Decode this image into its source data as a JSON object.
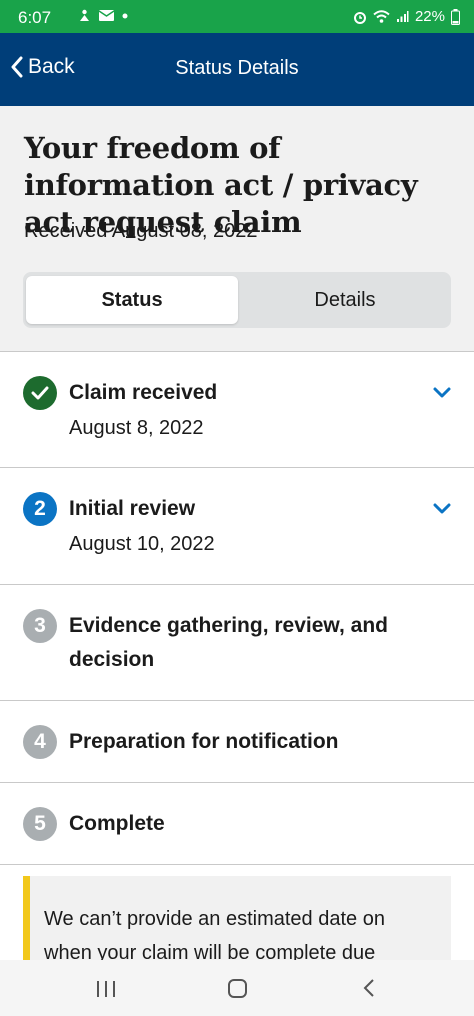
{
  "status_bar": {
    "time": "6:07",
    "battery": "22%",
    "icons_left": [
      "bluetooth-person-icon",
      "mail-icon",
      "dot-icon"
    ],
    "icons_right": [
      "alarm-icon",
      "wifi-icon",
      "signal-icon"
    ]
  },
  "nav": {
    "back_label": "Back",
    "title": "Status Details"
  },
  "header": {
    "title": "Your freedom of information act / privacy act request claim",
    "received": "Received August 08, 2022"
  },
  "tabs": [
    {
      "label": "Status",
      "selected": true
    },
    {
      "label": "Details",
      "selected": false
    }
  ],
  "steps": [
    {
      "number": "1",
      "state": "complete",
      "title": "Claim received",
      "date": "August 8, 2022",
      "expandable": true
    },
    {
      "number": "2",
      "state": "current",
      "title": "Initial review",
      "date": "August 10, 2022",
      "expandable": true
    },
    {
      "number": "3",
      "state": "upcoming",
      "title": "Evidence gathering, review, and decision",
      "date": "",
      "expandable": false
    },
    {
      "number": "4",
      "state": "upcoming",
      "title": "Preparation for notification",
      "date": "",
      "expandable": false
    },
    {
      "number": "5",
      "state": "upcoming",
      "title": "Complete",
      "date": "",
      "expandable": false
    }
  ],
  "alert": {
    "text": "We can’t provide an estimated date on when your claim will be complete due"
  },
  "colors": {
    "status_bar": "#19a34a",
    "nav_bar": "#003e79",
    "complete": "#1d6b2e",
    "current": "#0b74c4",
    "upcoming": "#a9aeb1",
    "alert_accent": "#f2c81b"
  }
}
